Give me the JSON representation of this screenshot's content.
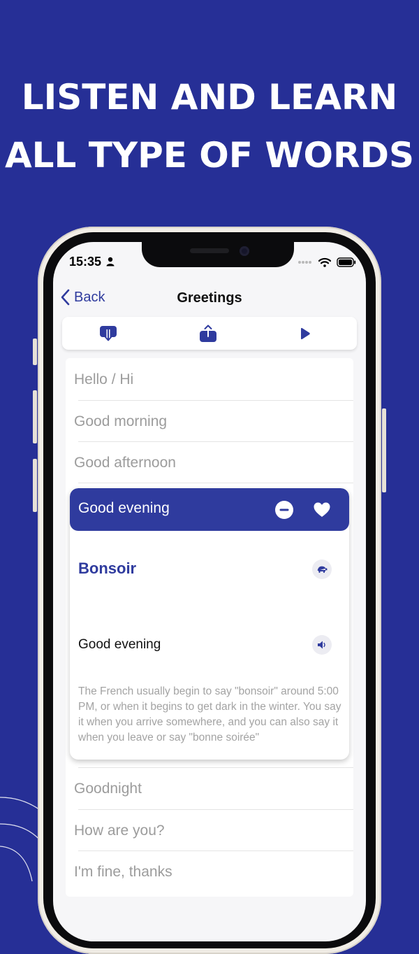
{
  "headline": {
    "line1": "LISTEN AND LEARN",
    "line2": "ALL TYPE OF WORDS"
  },
  "status_bar": {
    "time": "15:35"
  },
  "nav": {
    "back_label": "Back",
    "title": "Greetings"
  },
  "toolbar": {
    "icons": [
      "download-icon",
      "share-icon",
      "play-icon"
    ]
  },
  "list": {
    "items_before": [
      "Hello / Hi",
      "Good morning",
      "Good afternoon"
    ],
    "expanded": {
      "title": "Good evening",
      "translation": "Bonsoir",
      "english": "Good evening",
      "description": "The French usually begin to say \"bonsoir\" around 5:00 PM, or when it begins to get dark in the winter. You say it when you arrive somewhere, and you can also say it when you leave or say \"bonne soirée\""
    },
    "items_after": [
      "Goodnight",
      "How are you?",
      "I'm fine, thanks"
    ]
  },
  "colors": {
    "background": "#262f96",
    "accent": "#2f3b9e",
    "muted_text": "#9c9c9c"
  }
}
